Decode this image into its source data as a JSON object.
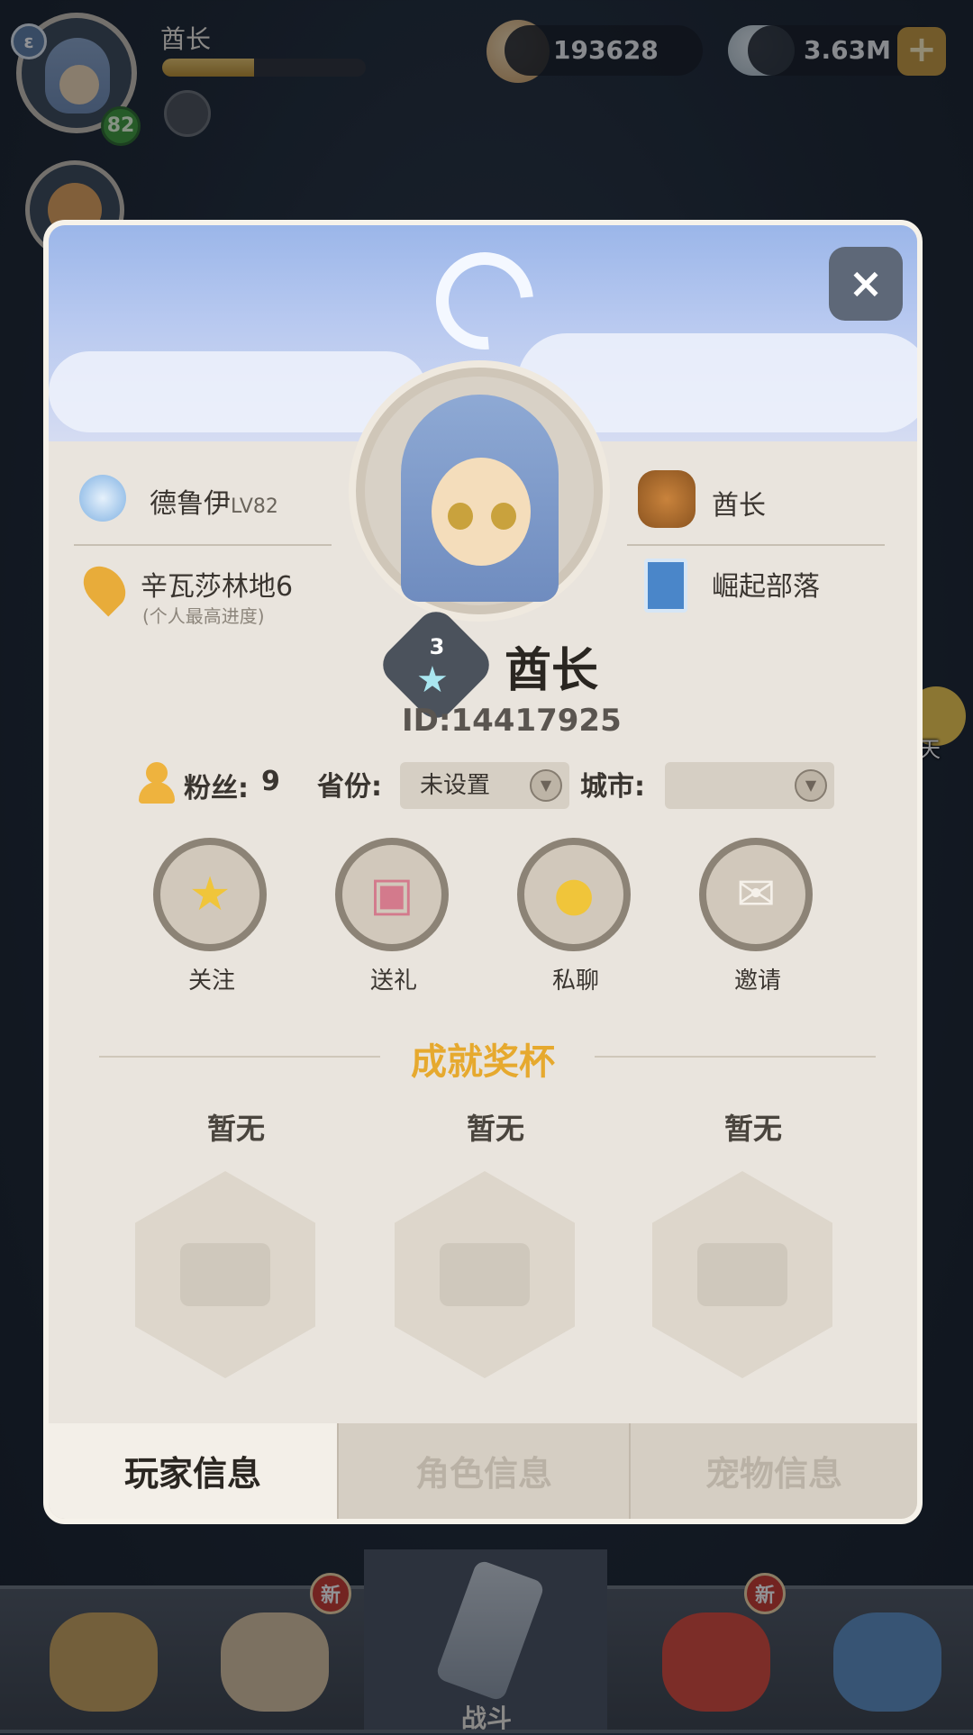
{
  "hud": {
    "player_name": "酋长",
    "level": "82",
    "exp_fraction": 0.45,
    "shells": "193628",
    "pearls": "3.63M",
    "plus": "+"
  },
  "chat": {
    "label": "聊天"
  },
  "bottom_nav": {
    "battle_label": "战斗",
    "new_badge_1": "新",
    "new_badge_2": "新"
  },
  "modal": {
    "close": "×",
    "class_name": "德鲁伊",
    "class_level": "LV82",
    "location": "辛瓦莎林地6",
    "location_note": "(个人最高进度)",
    "title_name": "酋长",
    "tribe": "崛起部落",
    "rank": "3",
    "player_name": "酋长",
    "player_id": "ID:14417925",
    "fans_label": "粉丝:",
    "fans_count": "9",
    "province_label": "省份:",
    "province_value": "未设置",
    "city_label": "城市:",
    "city_value": "",
    "actions": [
      {
        "label": "关注",
        "icon": "star-icon"
      },
      {
        "label": "送礼",
        "icon": "gift-icon"
      },
      {
        "label": "私聊",
        "icon": "chat-icon"
      },
      {
        "label": "邀请",
        "icon": "mail-icon"
      }
    ],
    "achievements_title": "成就奖杯",
    "trophies": [
      {
        "label": "暂无"
      },
      {
        "label": "暂无"
      },
      {
        "label": "暂无"
      }
    ],
    "tabs": [
      {
        "label": "玩家信息",
        "active": true
      },
      {
        "label": "角色信息",
        "active": false
      },
      {
        "label": "宠物信息",
        "active": false
      }
    ]
  }
}
